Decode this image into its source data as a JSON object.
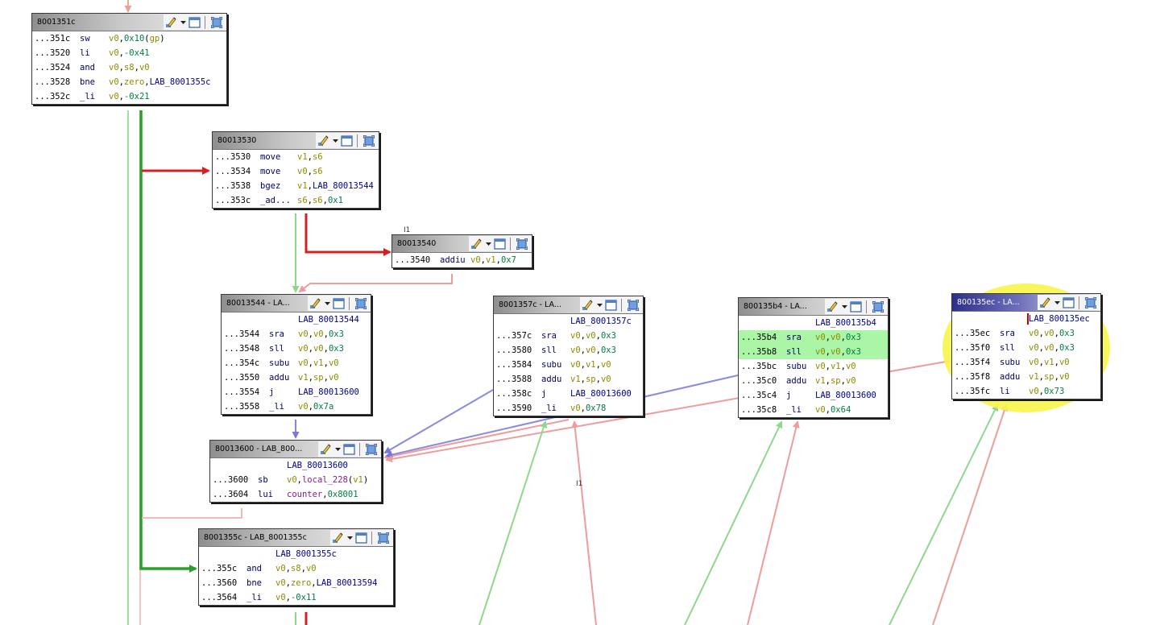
{
  "blocks": {
    "b8001351c": {
      "title": "8001351c",
      "rows": [
        {
          "addr": "...351c",
          "mn": "sw",
          "ops": [
            [
              "reg",
              "v0"
            ],
            [
              "punc",
              ","
            ],
            [
              "num",
              "0x10"
            ],
            [
              "punc",
              "("
            ],
            [
              "reg",
              "gp"
            ],
            [
              "punc",
              ")"
            ]
          ]
        },
        {
          "addr": "...3520",
          "mn": "li",
          "ops": [
            [
              "reg",
              "v0"
            ],
            [
              "punc",
              ","
            ],
            [
              "num",
              "-0x41"
            ]
          ]
        },
        {
          "addr": "...3524",
          "mn": "and",
          "ops": [
            [
              "reg",
              "v0"
            ],
            [
              "punc",
              ","
            ],
            [
              "reg",
              "s8"
            ],
            [
              "punc",
              ","
            ],
            [
              "reg",
              "v0"
            ]
          ]
        },
        {
          "addr": "...3528",
          "mn": "bne",
          "ops": [
            [
              "reg",
              "v0"
            ],
            [
              "punc",
              ","
            ],
            [
              "reg",
              "zero"
            ],
            [
              "punc",
              ","
            ],
            [
              "lbl",
              "LAB_8001355c"
            ]
          ]
        },
        {
          "addr": "...352c",
          "mn": "_li",
          "ops": [
            [
              "reg",
              "v0"
            ],
            [
              "punc",
              ","
            ],
            [
              "num",
              "-0x21"
            ]
          ]
        }
      ]
    },
    "b80013530": {
      "title": "80013530",
      "rows": [
        {
          "addr": "...3530",
          "mn": "move",
          "ops": [
            [
              "reg",
              "v1"
            ],
            [
              "punc",
              ","
            ],
            [
              "reg",
              "s6"
            ]
          ]
        },
        {
          "addr": "...3534",
          "mn": "move",
          "ops": [
            [
              "reg",
              "v0"
            ],
            [
              "punc",
              ","
            ],
            [
              "reg",
              "s6"
            ]
          ]
        },
        {
          "addr": "...3538",
          "mn": "bgez",
          "ops": [
            [
              "reg",
              "v1"
            ],
            [
              "punc",
              ","
            ],
            [
              "lbl",
              "LAB_80013544"
            ]
          ]
        },
        {
          "addr": "...353c",
          "mn": "_ad...",
          "ops": [
            [
              "reg",
              "s6"
            ],
            [
              "punc",
              ","
            ],
            [
              "reg",
              "s6"
            ],
            [
              "punc",
              ","
            ],
            [
              "num",
              "0x1"
            ]
          ]
        }
      ]
    },
    "b80013540": {
      "title": "80013540",
      "rows": [
        {
          "addr": "...3540",
          "mn": "addiu",
          "ops": [
            [
              "reg",
              "v0"
            ],
            [
              "punc",
              ","
            ],
            [
              "reg",
              "v1"
            ],
            [
              "punc",
              ","
            ],
            [
              "num",
              "0x7"
            ]
          ]
        }
      ]
    },
    "b80013544": {
      "title": "80013544 - LA...",
      "label": "LAB_80013544",
      "rows": [
        {
          "addr": "...3544",
          "mn": "sra",
          "ops": [
            [
              "reg",
              "v0"
            ],
            [
              "punc",
              ","
            ],
            [
              "reg",
              "v0"
            ],
            [
              "punc",
              ","
            ],
            [
              "num",
              "0x3"
            ]
          ]
        },
        {
          "addr": "...3548",
          "mn": "sll",
          "ops": [
            [
              "reg",
              "v0"
            ],
            [
              "punc",
              ","
            ],
            [
              "reg",
              "v0"
            ],
            [
              "punc",
              ","
            ],
            [
              "num",
              "0x3"
            ]
          ]
        },
        {
          "addr": "...354c",
          "mn": "subu",
          "ops": [
            [
              "reg",
              "v0"
            ],
            [
              "punc",
              ","
            ],
            [
              "reg",
              "v1"
            ],
            [
              "punc",
              ","
            ],
            [
              "reg",
              "v0"
            ]
          ]
        },
        {
          "addr": "...3550",
          "mn": "addu",
          "ops": [
            [
              "reg",
              "v1"
            ],
            [
              "punc",
              ","
            ],
            [
              "reg",
              "sp"
            ],
            [
              "punc",
              ","
            ],
            [
              "reg",
              "v0"
            ]
          ]
        },
        {
          "addr": "...3554",
          "mn": "j",
          "ops": [
            [
              "lbl",
              "LAB_80013600"
            ]
          ]
        },
        {
          "addr": "...3558",
          "mn": "_li",
          "ops": [
            [
              "reg",
              "v0"
            ],
            [
              "punc",
              ","
            ],
            [
              "num",
              "0x7a"
            ]
          ]
        }
      ]
    },
    "b8001357c": {
      "title": "8001357c - LA...",
      "label": "LAB_8001357c",
      "rows": [
        {
          "addr": "...357c",
          "mn": "sra",
          "ops": [
            [
              "reg",
              "v0"
            ],
            [
              "punc",
              ","
            ],
            [
              "reg",
              "v0"
            ],
            [
              "punc",
              ","
            ],
            [
              "num",
              "0x3"
            ]
          ]
        },
        {
          "addr": "...3580",
          "mn": "sll",
          "ops": [
            [
              "reg",
              "v0"
            ],
            [
              "punc",
              ","
            ],
            [
              "reg",
              "v0"
            ],
            [
              "punc",
              ","
            ],
            [
              "num",
              "0x3"
            ]
          ]
        },
        {
          "addr": "...3584",
          "mn": "subu",
          "ops": [
            [
              "reg",
              "v0"
            ],
            [
              "punc",
              ","
            ],
            [
              "reg",
              "v1"
            ],
            [
              "punc",
              ","
            ],
            [
              "reg",
              "v0"
            ]
          ]
        },
        {
          "addr": "...3588",
          "mn": "addu",
          "ops": [
            [
              "reg",
              "v1"
            ],
            [
              "punc",
              ","
            ],
            [
              "reg",
              "sp"
            ],
            [
              "punc",
              ","
            ],
            [
              "reg",
              "v0"
            ]
          ]
        },
        {
          "addr": "...358c",
          "mn": "j",
          "ops": [
            [
              "lbl",
              "LAB_80013600"
            ]
          ]
        },
        {
          "addr": "...3590",
          "mn": "_li",
          "ops": [
            [
              "reg",
              "v0"
            ],
            [
              "punc",
              ","
            ],
            [
              "num",
              "0x78"
            ]
          ]
        }
      ]
    },
    "b800135b4": {
      "title": "800135b4 - LA...",
      "label": "LAB_800135b4",
      "rows": [
        {
          "addr": "...35b4",
          "mn": "sra",
          "hl": true,
          "ops": [
            [
              "reg",
              "v0"
            ],
            [
              "punc",
              ","
            ],
            [
              "reg",
              "v0"
            ],
            [
              "punc",
              ","
            ],
            [
              "num",
              "0x3"
            ]
          ]
        },
        {
          "addr": "...35b8",
          "mn": "sll",
          "hl": true,
          "ops": [
            [
              "reg",
              "v0"
            ],
            [
              "punc",
              ","
            ],
            [
              "reg",
              "v0"
            ],
            [
              "punc",
              ","
            ],
            [
              "num",
              "0x3"
            ]
          ]
        },
        {
          "addr": "...35bc",
          "mn": "subu",
          "ops": [
            [
              "reg",
              "v0"
            ],
            [
              "punc",
              ","
            ],
            [
              "reg",
              "v1"
            ],
            [
              "punc",
              ","
            ],
            [
              "reg",
              "v0"
            ]
          ]
        },
        {
          "addr": "...35c0",
          "mn": "addu",
          "ops": [
            [
              "reg",
              "v1"
            ],
            [
              "punc",
              ","
            ],
            [
              "reg",
              "sp"
            ],
            [
              "punc",
              ","
            ],
            [
              "reg",
              "v0"
            ]
          ]
        },
        {
          "addr": "...35c4",
          "mn": "j",
          "ops": [
            [
              "lbl",
              "LAB_80013600"
            ]
          ]
        },
        {
          "addr": "...35c8",
          "mn": "_li",
          "ops": [
            [
              "reg",
              "v0"
            ],
            [
              "punc",
              ","
            ],
            [
              "num",
              "0x64"
            ]
          ]
        }
      ]
    },
    "b800135ec": {
      "title": "800135ec - LA...",
      "label": "LAB_800135ec",
      "rows": [
        {
          "addr": "...35ec",
          "mn": "sra",
          "ops": [
            [
              "reg",
              "v0"
            ],
            [
              "punc",
              ","
            ],
            [
              "reg",
              "v0"
            ],
            [
              "punc",
              ","
            ],
            [
              "num",
              "0x3"
            ]
          ]
        },
        {
          "addr": "...35f0",
          "mn": "sll",
          "ops": [
            [
              "reg",
              "v0"
            ],
            [
              "punc",
              ","
            ],
            [
              "reg",
              "v0"
            ],
            [
              "punc",
              ","
            ],
            [
              "num",
              "0x3"
            ]
          ]
        },
        {
          "addr": "...35f4",
          "mn": "subu",
          "ops": [
            [
              "reg",
              "v0"
            ],
            [
              "punc",
              ","
            ],
            [
              "reg",
              "v1"
            ],
            [
              "punc",
              ","
            ],
            [
              "reg",
              "v0"
            ]
          ]
        },
        {
          "addr": "...35f8",
          "mn": "addu",
          "ops": [
            [
              "reg",
              "v1"
            ],
            [
              "punc",
              ","
            ],
            [
              "reg",
              "sp"
            ],
            [
              "punc",
              ","
            ],
            [
              "reg",
              "v0"
            ]
          ]
        },
        {
          "addr": "...35fc",
          "mn": "li",
          "ops": [
            [
              "reg",
              "v0"
            ],
            [
              "punc",
              ","
            ],
            [
              "num",
              "0x73"
            ]
          ]
        }
      ]
    },
    "b80013600": {
      "title": "80013600 - LAB_800...",
      "label": "LAB_80013600",
      "rows": [
        {
          "addr": "...3600",
          "mn": "sb",
          "ops": [
            [
              "reg",
              "v0"
            ],
            [
              "punc",
              ","
            ],
            [
              "loc",
              "local_228"
            ],
            [
              "punc",
              "("
            ],
            [
              "reg",
              "v1"
            ],
            [
              "punc",
              ")"
            ]
          ]
        },
        {
          "addr": "...3604",
          "mn": "lui",
          "ops": [
            [
              "loc",
              "counter"
            ],
            [
              "punc",
              ","
            ],
            [
              "num",
              "0x8001"
            ]
          ]
        }
      ]
    },
    "b8001355c": {
      "title": "8001355c - LAB_8001355c",
      "label": "LAB_8001355c",
      "rows": [
        {
          "addr": "...355c",
          "mn": "and",
          "ops": [
            [
              "reg",
              "v0"
            ],
            [
              "punc",
              ","
            ],
            [
              "reg",
              "s8"
            ],
            [
              "punc",
              ","
            ],
            [
              "reg",
              "v0"
            ]
          ]
        },
        {
          "addr": "...3560",
          "mn": "bne",
          "ops": [
            [
              "reg",
              "v0"
            ],
            [
              "punc",
              ","
            ],
            [
              "reg",
              "zero"
            ],
            [
              "punc",
              ","
            ],
            [
              "lbl",
              "LAB_80013594"
            ]
          ]
        },
        {
          "addr": "...3564",
          "mn": "_li",
          "ops": [
            [
              "reg",
              "v0"
            ],
            [
              "punc",
              ","
            ],
            [
              "num",
              "-0x11"
            ]
          ]
        }
      ]
    }
  },
  "edge_colors": {
    "fallthrough": "#3fc03f",
    "fallthrough_light": "#9fe09f",
    "taken": "#d42020",
    "taken_light": "#f0a8a8",
    "jump": "#8a8ae0",
    "taken_bold": "#2aa02a"
  },
  "icons": {
    "edit": "edit-pencil-icon",
    "menu": "dropdown-arrow-icon",
    "restore": "restore-window-icon",
    "fit": "fit-graph-icon"
  },
  "selected_block": "b800135ec",
  "highlight_color": "#f8f54a",
  "markers": [
    "I1",
    "I1"
  ]
}
